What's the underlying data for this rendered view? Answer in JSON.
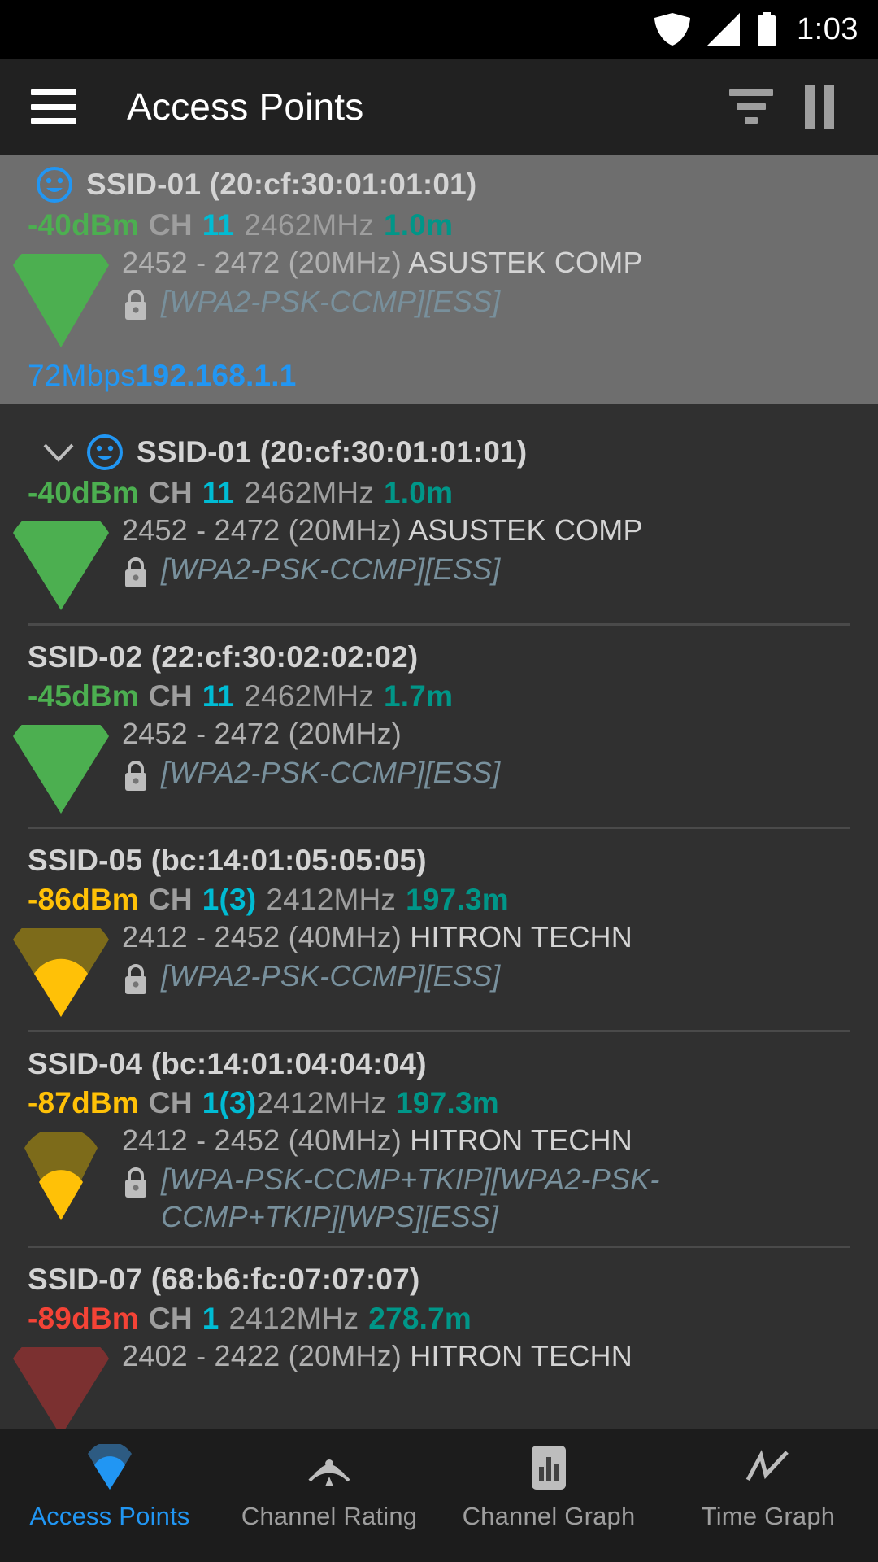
{
  "status_bar": {
    "time": "1:03",
    "icons": [
      "wifi-icon",
      "cell-signal-icon",
      "battery-icon"
    ]
  },
  "app_bar": {
    "menu_icon": "hamburger-menu-icon",
    "title": "Access Points",
    "filter_icon": "filter-icon",
    "pause_icon": "pause-icon"
  },
  "connected_ap": {
    "status_icon": "smiley-face-icon",
    "ssid": "SSID-01 (20:cf:30:01:01:01)",
    "level": "-40dBm",
    "level_color": "#4caf50",
    "ch_label": "CH",
    "channel": "11",
    "frequency": "2462MHz",
    "distance": "1.0m",
    "range": "2452 - 2472 (20MHz)",
    "vendor": "ASUSTEK COMP",
    "security": "[WPA2-PSK-CCMP][ESS]",
    "link_speed": "72Mbps",
    "ip_address": "192.168.1.1",
    "signal_bars": 4,
    "cone_color": "#4caf50"
  },
  "access_points": [
    {
      "expander_icon": "chevron-down-icon",
      "status_icon": "smiley-face-icon",
      "ssid": "SSID-01 (20:cf:30:01:01:01)",
      "level": "-40dBm",
      "level_color": "#4caf50",
      "ch_label": "CH",
      "channel": "11",
      "frequency": "2462MHz",
      "distance": "1.0m",
      "range": "2452 - 2472 (20MHz)",
      "vendor": "ASUSTEK COMP",
      "security": "[WPA2-PSK-CCMP][ESS]",
      "signal_bars": 4,
      "cone_color": "#4caf50",
      "cone_dim": "#2f5c31",
      "cone_wide": true
    },
    {
      "ssid": "SSID-02 (22:cf:30:02:02:02)",
      "level": "-45dBm",
      "level_color": "#4caf50",
      "ch_label": "CH",
      "channel": "11",
      "frequency": "2462MHz",
      "distance": "1.7m",
      "range": "2452 - 2472 (20MHz)",
      "vendor": "",
      "security": "[WPA2-PSK-CCMP][ESS]",
      "signal_bars": 4,
      "cone_color": "#4caf50",
      "cone_dim": "#2f5c31",
      "cone_wide": true
    },
    {
      "ssid": "SSID-05 (bc:14:01:05:05:05)",
      "level": "-86dBm",
      "level_color": "#ffc107",
      "ch_label": "CH",
      "channel": "1(3)",
      "frequency": "2412MHz",
      "distance": "197.3m",
      "range": "2412 - 2452 (40MHz)",
      "vendor": "HITRON TECHN",
      "security": "[WPA2-PSK-CCMP][ESS]",
      "signal_bars": 1,
      "cone_color": "#ffc107",
      "cone_dim": "#7d6b1a",
      "cone_wide": true
    },
    {
      "ssid": "SSID-04 (bc:14:01:04:04:04)",
      "level": "-87dBm",
      "level_color": "#ffc107",
      "ch_label": "CH",
      "channel": "1(3)",
      "frequency": "2412MHz",
      "distance": "197.3m",
      "range": "2412 - 2452 (40MHz)",
      "vendor": "HITRON TECHN",
      "security": "[WPA-PSK-CCMP+TKIP][WPA2-PSK-CCMP+TKIP][WPS][ESS]",
      "signal_bars": 1,
      "cone_color": "#ffc107",
      "cone_dim": "#7d6b1a",
      "cone_wide": false
    },
    {
      "ssid": "SSID-07 (68:b6:fc:07:07:07)",
      "level": "-89dBm",
      "level_color": "#f44336",
      "ch_label": "CH",
      "channel": "1",
      "frequency": "2412MHz",
      "distance": "278.7m",
      "range": "2402 - 2422 (20MHz)",
      "vendor": "HITRON TECHN",
      "security": "",
      "signal_bars": 0,
      "cone_color": "#7b3030",
      "cone_dim": "#7b3030",
      "cone_wide": true
    }
  ],
  "bottom_nav": [
    {
      "label": "Access Points",
      "icon": "wifi-cone-icon",
      "active": true
    },
    {
      "label": "Channel Rating",
      "icon": "radar-waves-icon",
      "active": false
    },
    {
      "label": "Channel Graph",
      "icon": "bar-chart-icon",
      "active": false
    },
    {
      "label": "Time Graph",
      "icon": "line-chart-icon",
      "active": false
    }
  ]
}
